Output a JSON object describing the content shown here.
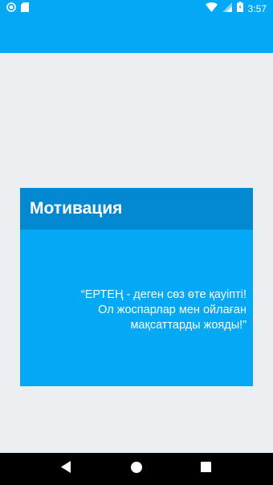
{
  "status_bar": {
    "time": "3:57",
    "icons": [
      "circle-notification-icon",
      "sd-card-icon",
      "wifi-icon",
      "signal-icon",
      "battery-icon"
    ]
  },
  "app_bar": {
    "title": ""
  },
  "card": {
    "title": "Мотивация",
    "quote_lines": [
      "“ЕРТЕҢ - деген сөз өте қауіпті!",
      "Ол жоспарлар мен ойлаған",
      "мақсаттарды жояды!”"
    ]
  },
  "colors": {
    "primary": "#03a9f4",
    "primary_dark": "#0288d1",
    "background": "#eceff1",
    "nav_bar": "#000000"
  },
  "nav_bar": {
    "buttons": [
      "back-icon",
      "home-icon",
      "recents-icon"
    ]
  }
}
